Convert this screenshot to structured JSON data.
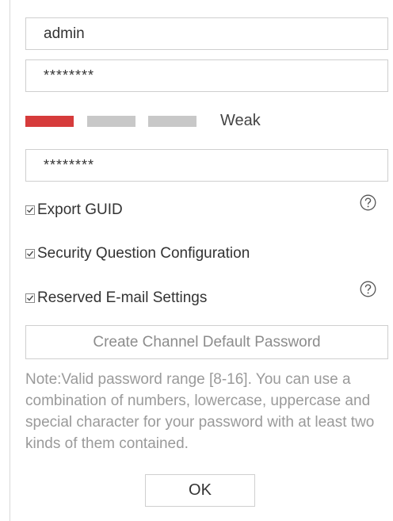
{
  "form": {
    "username": "admin",
    "password": "********",
    "confirm_password": "********"
  },
  "strength": {
    "label": "Weak",
    "level": 1,
    "segments": 3,
    "active_color": "#d63b3b",
    "inactive_color": "#c8c8c8"
  },
  "options": {
    "export_guid": {
      "label": "Export GUID",
      "checked": true
    },
    "security_question": {
      "label": "Security Question Configuration",
      "checked": true
    },
    "reserved_email": {
      "label": "Reserved E-mail Settings",
      "checked": true
    }
  },
  "buttons": {
    "create_default_password": "Create Channel Default Password",
    "ok": "OK"
  },
  "note": "Note:Valid password range [8-16]. You can use a combination of numbers, lowercase, uppercase and special character for your password with at least two kinds of them contained.",
  "colors": {
    "border": "#cfcfcf",
    "note_text": "#9a9a9a",
    "weak": "#d63b3b"
  }
}
